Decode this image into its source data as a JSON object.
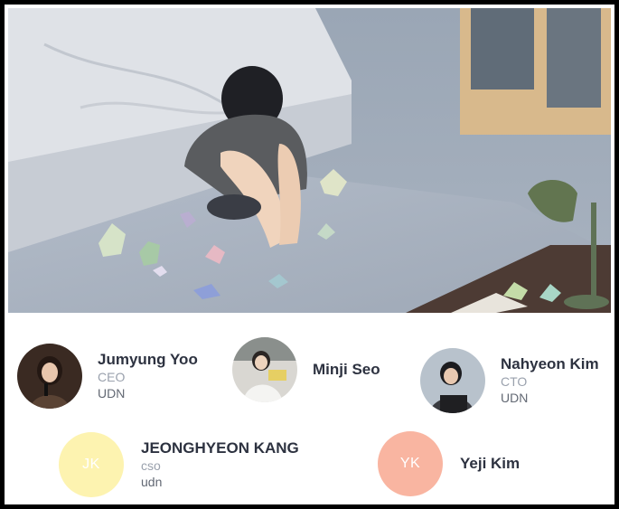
{
  "team": {
    "members": [
      {
        "name": "Jumyung Yoo",
        "role": "CEO",
        "org": "UDN",
        "avatar": "photo"
      },
      {
        "name": "Minji Seo",
        "role": "",
        "org": "",
        "avatar": "photo"
      },
      {
        "name": "Nahyeon Kim",
        "role": "CTO",
        "org": "UDN",
        "avatar": "photo"
      },
      {
        "name": "JEONGHYEON KANG",
        "role": "cso",
        "org": "udn",
        "avatar": "initials",
        "initials": "JK",
        "color": "#fdf3b0"
      },
      {
        "name": "Yeji Kim",
        "role": "",
        "org": "",
        "avatar": "initials",
        "initials": "YK",
        "color": "#f9b5a1"
      }
    ]
  },
  "colors": {
    "name_text": "#2d3240",
    "role_text": "#9aa1ad",
    "org_text": "#626873",
    "frame_border": "#000000"
  }
}
